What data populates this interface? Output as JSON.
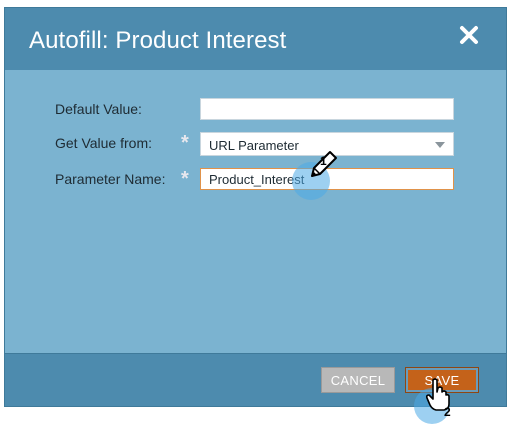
{
  "dialog": {
    "title": "Autofill: Product Interest",
    "close_icon": "close-icon"
  },
  "form": {
    "default_value": {
      "label": "Default Value:",
      "value": ""
    },
    "get_value_from": {
      "label": "Get Value from:",
      "value": "URL Parameter",
      "required": true
    },
    "parameter_name": {
      "label": "Parameter Name:",
      "value": "Product_Interest",
      "required": true
    },
    "required_mark": "*"
  },
  "footer": {
    "cancel_label": "CANCEL",
    "save_label": "SAVE"
  },
  "annotations": {
    "step1": "1",
    "step2": "2"
  },
  "colors": {
    "header": "#4d8bae",
    "body": "#7bb3d0",
    "save": "#c4621a",
    "cancel": "#b8b8b8",
    "active_border": "#e0924a"
  }
}
